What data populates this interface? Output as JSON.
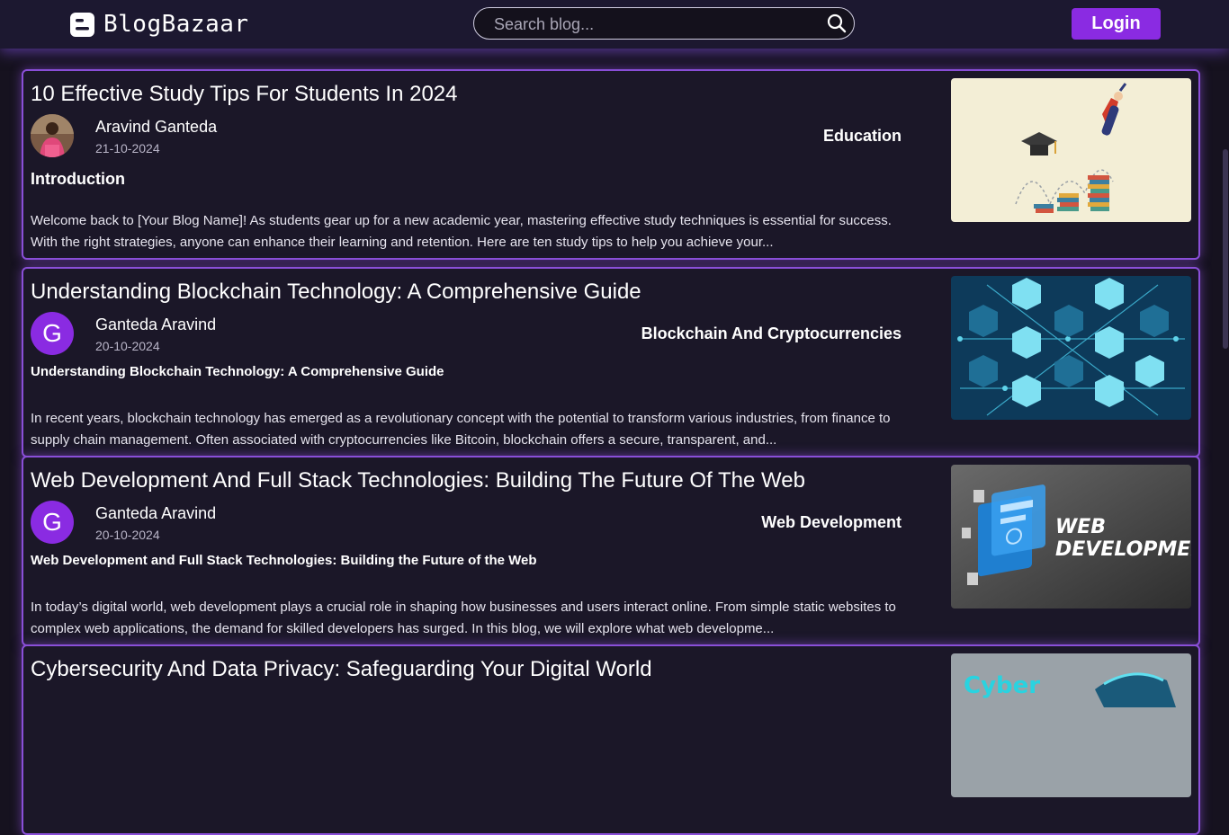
{
  "app": {
    "name": "BlogBazaar"
  },
  "header": {
    "search_placeholder": "Search blog...",
    "login_label": "Login"
  },
  "colors": {
    "accent": "#8a2be2",
    "card_border": "#8a4fd8",
    "background": "#16121f"
  },
  "posts": [
    {
      "title": "10 Effective Study Tips For Students In 2024",
      "author": "Aravind Ganteda",
      "date": "21-10-2024",
      "category": "Education",
      "heading": "Introduction",
      "excerpt": "Welcome back to [Your Blog Name]! As students gear up for a new academic year, mastering effective study techniques is essential for success. With the right strategies, anyone can enhance their learning and retention. Here are ten study tips to help you achieve your...",
      "avatar_icon": "user-photo",
      "thumbnail_icon": "graduation-books-illustration"
    },
    {
      "title": "Understanding Blockchain Technology: A Comprehensive Guide",
      "author": "Ganteda Aravind",
      "date": "20-10-2024",
      "category": "Blockchain And Cryptocurrencies",
      "heading": "Understanding Blockchain Technology: A Comprehensive Guide",
      "excerpt": "In recent years, blockchain technology has emerged as a revolutionary concept with the potential to transform various industries, from finance to supply chain management. Often associated with cryptocurrencies like Bitcoin, blockchain offers a secure, transparent, and...",
      "avatar_letter": "G",
      "thumbnail_icon": "nft-cubes-network"
    },
    {
      "title": "Web Development And Full Stack Technologies: Building The Future Of The Web",
      "author": "Ganteda Aravind",
      "date": "20-10-2024",
      "category": "Web Development",
      "heading": "Web Development and Full Stack Technologies: Building the Future of the Web",
      "excerpt": "In today’s digital world, web development plays a crucial role in shaping how businesses and users interact online. From simple static websites to complex web applications, the demand for skilled developers has surged. In this blog, we will explore what web developme...",
      "avatar_letter": "G",
      "thumbnail_text_1": "WEB",
      "thumbnail_text_2": "DEVELOPMENT",
      "thumbnail_icon": "web-development-illustration"
    },
    {
      "title": "Cybersecurity And Data Privacy: Safeguarding Your Digital World",
      "thumbnail_text": "Cyber",
      "thumbnail_icon": "cybersecurity-illustration"
    }
  ]
}
